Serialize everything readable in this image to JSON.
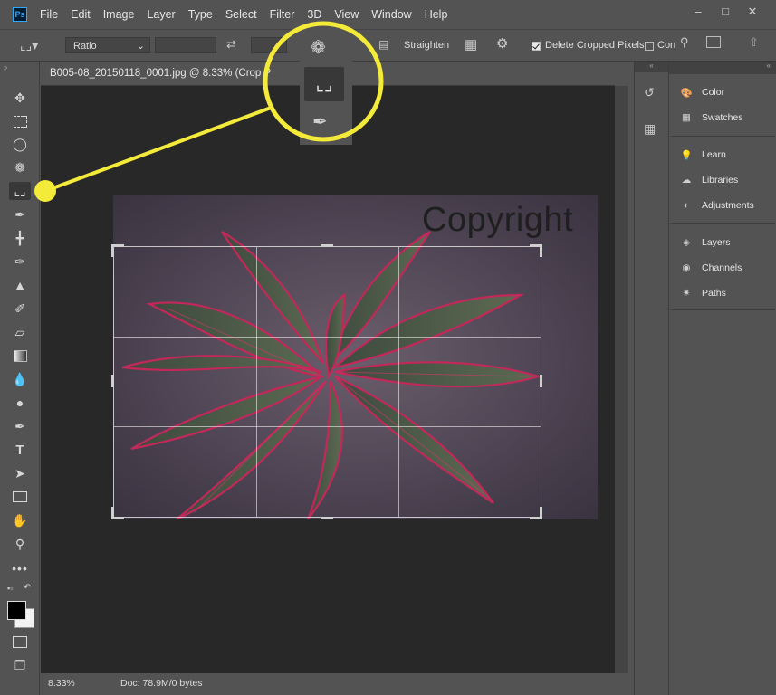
{
  "app": {
    "logo": "Ps"
  },
  "menu": [
    "File",
    "Edit",
    "Image",
    "Layer",
    "Type",
    "Select",
    "Filter",
    "3D",
    "View",
    "Window",
    "Help"
  ],
  "window_controls": [
    "minimize-icon",
    "restore-icon",
    "close-icon"
  ],
  "options": {
    "ratio_label": "Ratio",
    "ratio_width": "",
    "ratio_height": "",
    "straighten_label": "Straighten",
    "delete_cropped_label": "Delete Cropped Pixels",
    "delete_cropped_checked": true,
    "content_aware_label": "Con",
    "content_aware_checked": false
  },
  "document": {
    "tab_title": "B005-08_20150118_0001.jpg @ 8.33% (Crop P",
    "zoom": "8.33%",
    "doc_info": "Doc: 78.9M/0 bytes",
    "watermark": "Copyright"
  },
  "tools": [
    "move",
    "marquee",
    "lasso",
    "quick-selection",
    "crop",
    "eyedropper",
    "healing",
    "brush",
    "stamp",
    "history-brush",
    "eraser",
    "gradient",
    "blur",
    "dodge",
    "pen",
    "type",
    "path-selection",
    "rectangle",
    "hand",
    "zoom",
    "more",
    "default-colors",
    "swap-colors",
    "foreground-color",
    "background-color",
    "quick-mask",
    "screen-mode"
  ],
  "panels": {
    "group1": [
      "Color",
      "Swatches"
    ],
    "group2": [
      "Learn",
      "Libraries",
      "Adjustments"
    ],
    "group3": [
      "Layers",
      "Channels",
      "Paths"
    ]
  },
  "colors": {
    "ui_bg": "#535353",
    "canvas_bg": "#282828",
    "callout": "#f4ea3a"
  }
}
